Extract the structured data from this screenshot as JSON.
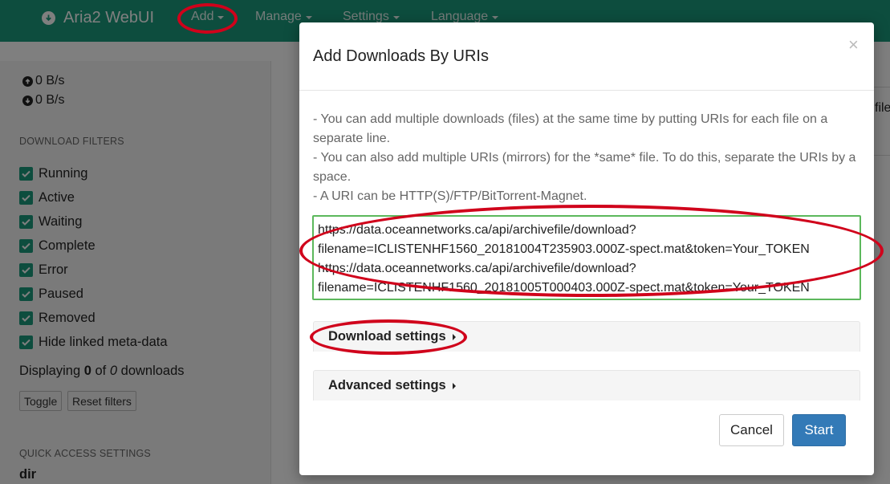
{
  "navbar": {
    "brand": "Aria2 WebUI",
    "brand_icon": "download-circle-icon",
    "items": [
      {
        "label": "Add"
      },
      {
        "label": "Manage"
      },
      {
        "label": "Settings"
      },
      {
        "label": "Language"
      }
    ]
  },
  "sidebar": {
    "upload_speed": "0 B/s",
    "download_speed": "0 B/s",
    "filters_title": "DOWNLOAD FILTERS",
    "filters": [
      {
        "label": "Running",
        "checked": true
      },
      {
        "label": "Active",
        "checked": true
      },
      {
        "label": "Waiting",
        "checked": true
      },
      {
        "label": "Complete",
        "checked": true
      },
      {
        "label": "Error",
        "checked": true
      },
      {
        "label": "Paused",
        "checked": true
      },
      {
        "label": "Removed",
        "checked": true
      },
      {
        "label": "Hide linked meta-data",
        "checked": true
      }
    ],
    "displaying_prefix": "Displaying",
    "displaying_count": "0",
    "displaying_of": "of",
    "displaying_total": "0",
    "displaying_suffix": "downloads",
    "toggle_label": "Toggle",
    "reset_label": "Reset filters",
    "quick_title": "QUICK ACCESS SETTINGS",
    "dir_label": "dir"
  },
  "main": {
    "partial_text": "file"
  },
  "modal": {
    "title": "Add Downloads By URIs",
    "close_label": "×",
    "help_lines": [
      "- You can add multiple downloads (files) at the same time by putting URIs for each file on a",
      "separate line.",
      "- You can also add multiple URIs (mirrors) for the *same* file. To do this, separate the URIs by a",
      "space.",
      "- A URI can be HTTP(S)/FTP/BitTorrent-Magnet."
    ],
    "uri_value": "https://data.oceannetworks.ca/api/archivefile/download?\nfilename=ICLISTENHF1560_20181004T235903.000Z-spect.mat&token=Your_TOKEN\nhttps://data.oceannetworks.ca/api/archivefile/download?\nfilename=ICLISTENHF1560_20181005T000403.000Z-spect.mat&token=Your_TOKEN",
    "download_settings_label": "Download settings",
    "advanced_settings_label": "Advanced settings",
    "cancel_label": "Cancel",
    "start_label": "Start"
  },
  "colors": {
    "navbar": "#1a9a7d",
    "checkbox": "#1a9a7d",
    "primary_button": "#337ab7",
    "uri_border": "#5cb85c",
    "annotation": "#d0021b"
  }
}
